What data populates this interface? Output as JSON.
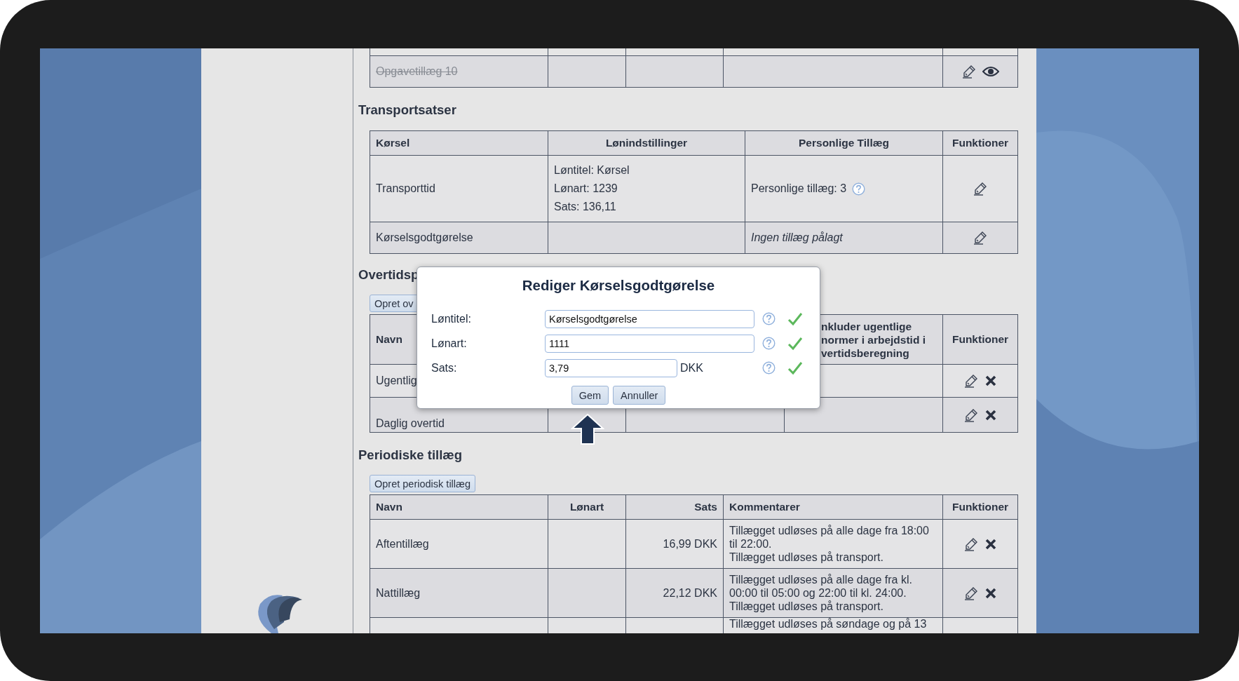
{
  "top_table": {
    "rows": [
      {
        "name": "Opgavetillæg 10",
        "struck": true,
        "actions": [
          {
            "kind": "edit"
          },
          {
            "kind": "view"
          }
        ]
      }
    ]
  },
  "transport": {
    "title": "Transportsatser",
    "columns": [
      "Kørsel",
      "Lønindstillinger",
      "Personlige Tillæg",
      "Funktioner"
    ],
    "rows": [
      {
        "name": "Transporttid",
        "settings": [
          "Løntitel: Kørsel",
          "Lønart: 1239",
          "Sats: 136,11"
        ],
        "personal": {
          "kind": "count",
          "text": "Personlige tillæg: 3"
        },
        "actions": [
          {
            "kind": "edit"
          }
        ]
      },
      {
        "name": "Kørselsgodtgørelse",
        "personal": {
          "kind": "none",
          "text": "Ingen tillæg pålagt"
        },
        "actions": [
          {
            "kind": "edit"
          }
        ]
      }
    ]
  },
  "overtime": {
    "title": "Overtidsp",
    "create_button": "Opret ov",
    "columns": [
      "Navn",
      "nkluder ugentlige normer i arbejdstid i vertidsberegning",
      "Funktioner"
    ],
    "rows": [
      {
        "name": "Ugentlig",
        "actions": [
          {
            "kind": "edit"
          },
          {
            "kind": "delete"
          }
        ]
      },
      {
        "name": "Daglig overtid",
        "actions": [
          {
            "kind": "edit"
          },
          {
            "kind": "delete"
          }
        ]
      }
    ]
  },
  "periodic": {
    "title": "Periodiske tillæg",
    "create_button": "Opret periodisk tillæg",
    "columns": [
      "Navn",
      "Lønart",
      "Sats",
      "Kommentarer",
      "Funktioner"
    ],
    "rows": [
      {
        "name": "Aftentillæg",
        "rate": "16,99 DKK",
        "comment": [
          "Tillægget udløses på alle dage fra 18:00",
          "til 22:00.",
          "Tillægget udløses på transport."
        ],
        "actions": [
          {
            "kind": "edit"
          },
          {
            "kind": "delete"
          }
        ]
      },
      {
        "name": "Nattillæg",
        "rate": "22,12 DKK",
        "comment": [
          "Tillægget udløses på alle dage fra kl.",
          "00:00 til 05:00 og 22:00 til kl. 24:00.",
          "Tillægget udløses på transport."
        ],
        "actions": [
          {
            "kind": "edit"
          },
          {
            "kind": "delete"
          }
        ]
      },
      {
        "comment": [
          "Tillægget udløses på søndage og på 13"
        ]
      }
    ]
  },
  "dialog": {
    "title": "Rediger Kørselsgodtgørelse",
    "fields": [
      {
        "label": "Løntitel:",
        "value": "Kørselsgodtgørelse",
        "kind": "wide",
        "valid": true
      },
      {
        "label": "Lønart:",
        "value": "1111",
        "kind": "wide",
        "valid": true
      },
      {
        "label": "Sats:",
        "value": "3,79",
        "unit": "DKK",
        "kind": "short",
        "valid": true
      }
    ],
    "buttons": [
      "Gem",
      "Annuller"
    ]
  }
}
